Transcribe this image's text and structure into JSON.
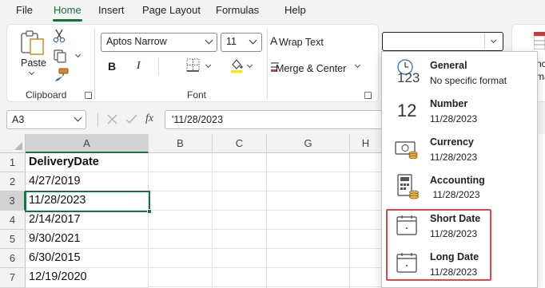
{
  "menu": {
    "file": "File",
    "home": "Home",
    "insert": "Insert",
    "page_layout": "Page Layout",
    "formulas": "Formulas",
    "help": "Help"
  },
  "ribbon": {
    "clipboard": {
      "paste_label": "Paste",
      "group_label": "Clipboard"
    },
    "font": {
      "font_name": "Aptos Narrow",
      "font_size": "11",
      "bold_label": "B",
      "italic_label": "I",
      "group_label": "Font"
    },
    "alignment": {
      "wrap_text_label": "Wrap Text",
      "merge_center_label": "Merge & Center"
    },
    "number_format_value": ""
  },
  "formula_bar": {
    "name_box": "A3",
    "fx_label": "fx",
    "content": "'11/28/2023"
  },
  "grid": {
    "columns": [
      "A",
      "B",
      "C",
      "G",
      "H"
    ],
    "rows": [
      "1",
      "2",
      "3",
      "4",
      "5",
      "6",
      "7"
    ],
    "column_a_values": [
      "DeliveryDate",
      "4/27/2019",
      "11/28/2023",
      "2/14/2017",
      "9/30/2021",
      "6/30/2015",
      "12/19/2020"
    ],
    "selected_cell": "A3"
  },
  "number_format_dropdown": {
    "items": [
      {
        "icon": "clock-123-icon",
        "title": "General",
        "subtitle": "No specific format",
        "glyph": "123"
      },
      {
        "icon": "number-12-icon",
        "title": "Number",
        "subtitle": "11/28/2023",
        "glyph": "12"
      },
      {
        "icon": "currency-icon",
        "title": "Currency",
        "subtitle": "11/28/2023"
      },
      {
        "icon": "accounting-calculator-icon",
        "title": "Accounting",
        "subtitle": " 11/28/2023"
      },
      {
        "icon": "calendar-icon",
        "title": "Short Date",
        "subtitle": "11/28/2023"
      },
      {
        "icon": "calendar-icon",
        "title": "Long Date",
        "subtitle": "11/28/2023"
      }
    ],
    "highlighted": [
      "Short Date",
      "Long Date"
    ],
    "highlight_color": "#e04848"
  },
  "colors": {
    "accent_green": "#1e6b3c",
    "ribbon_bg": "#f3f3f3",
    "selection_green": "#1e7145"
  },
  "partial_text": {
    "right_edge_1": "nc",
    "right_edge_2": "ma"
  }
}
